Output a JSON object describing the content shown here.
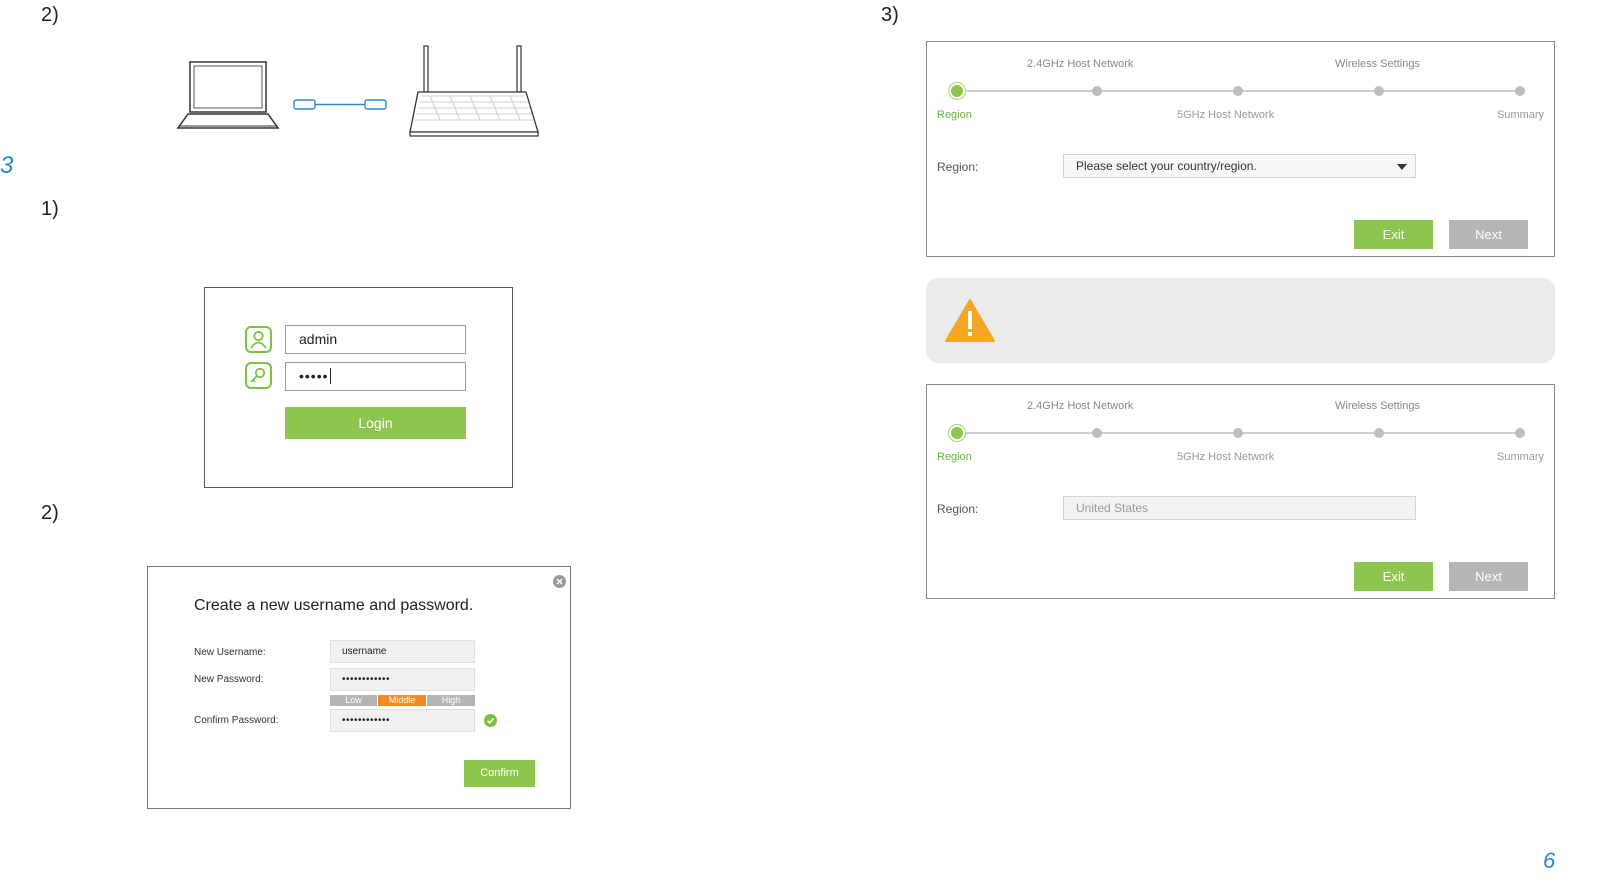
{
  "left": {
    "step_top": "2)",
    "section": "3",
    "step_login": "1)",
    "step_create": "2)"
  },
  "login": {
    "username_value": "admin",
    "password_value": "•••••",
    "login_label": "Login",
    "user_icon": "user-icon",
    "key_icon": "key-icon"
  },
  "create": {
    "title": "Create a new username and password.",
    "username_label": "New Username:",
    "username_value": "username",
    "password_label": "New Password:",
    "password_value": "••••••••••••",
    "strength": [
      "Low",
      "Middle",
      "High"
    ],
    "strength_active": "Middle",
    "confirm_label": "Confirm Password:",
    "confirm_value": "••••••••••••",
    "confirm_button": "Confirm",
    "close_icon": "close-icon",
    "check_icon": "check-icon",
    "colors": {
      "green": "#8dc64f",
      "orange": "#f08c21",
      "gray": "#b5b5b5"
    }
  },
  "right": {
    "step": "3)",
    "page_number": "6"
  },
  "wizard1": {
    "steps_top": [
      "2.4GHz Host Network",
      "Wireless Settings"
    ],
    "steps_bottom": [
      "Region",
      "5GHz Host Network",
      "Summary"
    ],
    "region_label": "Region:",
    "region_value": "Please select your country/region.",
    "exit_label": "Exit",
    "next_label": "Next"
  },
  "warning": {
    "icon": "warning-triangle-icon"
  },
  "wizard2": {
    "steps_top": [
      "2.4GHz Host Network",
      "Wireless Settings"
    ],
    "steps_bottom": [
      "Region",
      "5GHz Host Network",
      "Summary"
    ],
    "region_label": "Region:",
    "region_value": "United States",
    "exit_label": "Exit",
    "next_label": "Next"
  }
}
